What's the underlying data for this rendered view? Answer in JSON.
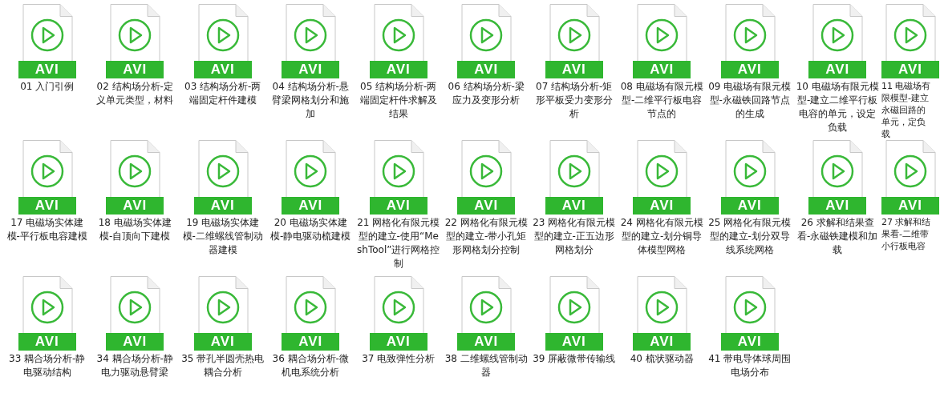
{
  "files": [
    {
      "type": "AVI",
      "label": "01 入门引例"
    },
    {
      "type": "AVI",
      "label": "02 结构场分析-定义单元类型，材料"
    },
    {
      "type": "AVI",
      "label": "03 结构场分析-两端固定杆件建模"
    },
    {
      "type": "AVI",
      "label": "04 结构场分析-悬臂梁网格划分和施加"
    },
    {
      "type": "AVI",
      "label": "05 结构场分析-两端固定杆件求解及结果"
    },
    {
      "type": "AVI",
      "label": "06 结构场分析-梁应力及变形分析"
    },
    {
      "type": "AVI",
      "label": "07 结构场分析-矩形平板受力变形分析"
    },
    {
      "type": "AVI",
      "label": "08 电磁场有限元模型-二维平行板电容节点的"
    },
    {
      "type": "AVI",
      "label": "09 电磁场有限元模型-永磁铁回路节点的生成"
    },
    {
      "type": "AVI",
      "label": "10 电磁场有限元模型-建立二维平行板电容的单元，设定负载"
    },
    {
      "type": "AVI",
      "label": "11 电磁场有限模型-建立永磁回路的单元，定负载"
    },
    {
      "type": "AVI",
      "label": "17 电磁场实体建模-平行板电容建模"
    },
    {
      "type": "AVI",
      "label": "18 电磁场实体建模-自顶向下建模"
    },
    {
      "type": "AVI",
      "label": "19 电磁场实体建模-二维螺线管制动器建模"
    },
    {
      "type": "AVI",
      "label": "20 电磁场实体建模-静电驱动梳建模"
    },
    {
      "type": "AVI",
      "label": "21 网格化有限元模型的建立-使用“MeshTool”进行网格控制"
    },
    {
      "type": "AVI",
      "label": "22 网格化有限元模型的建立-带小孔矩形网格划分控制"
    },
    {
      "type": "AVI",
      "label": "23 网格化有限元模型的建立-正五边形网格划分"
    },
    {
      "type": "AVI",
      "label": "24 网格化有限元模型的建立-划分铜导体模型网格"
    },
    {
      "type": "AVI",
      "label": "25 网格化有限元模型的建立-划分双导线系统网格"
    },
    {
      "type": "AVI",
      "label": "26 求解和结果查看-永磁铁建模和加载"
    },
    {
      "type": "AVI",
      "label": "27 求解和结果看-二维带小行板电容"
    },
    {
      "type": "AVI",
      "label": "33 耦合场分析-静电驱动结构"
    },
    {
      "type": "AVI",
      "label": "34 耦合场分析-静电力驱动悬臂梁"
    },
    {
      "type": "AVI",
      "label": "35 带孔半圆壳热电耦合分析"
    },
    {
      "type": "AVI",
      "label": "36 耦合场分析-微机电系统分析"
    },
    {
      "type": "AVI",
      "label": "37 电致弹性分析"
    },
    {
      "type": "AVI",
      "label": "38 二维螺线管制动器"
    },
    {
      "type": "AVI",
      "label": "39 屏蔽微带传输线"
    },
    {
      "type": "AVI",
      "label": "40 梳状驱动器"
    },
    {
      "type": "AVI",
      "label": "41 带电导体球周围电场分布"
    }
  ]
}
